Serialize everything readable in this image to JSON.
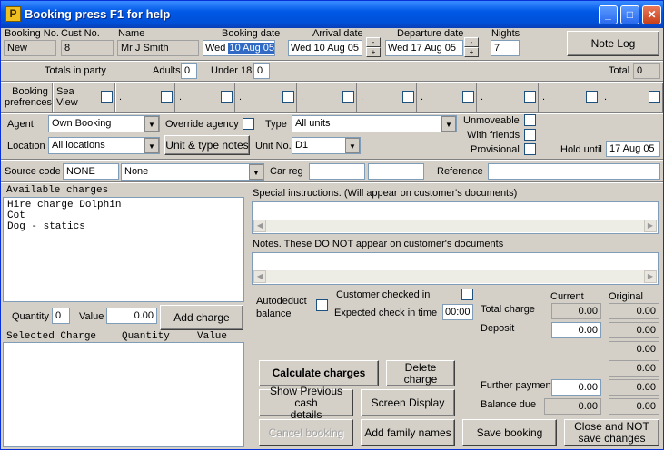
{
  "window": {
    "title": "Booking press F1 for help",
    "app_icon_letter": "P"
  },
  "header": {
    "booking_no_label": "Booking No.",
    "booking_no": "New",
    "cust_no_label": "Cust No.",
    "cust_no": "8",
    "name_label": "Name",
    "name": "Mr J Smith",
    "booking_date_label": "Booking date",
    "booking_day": "Wed",
    "booking_date": "10 Aug 05",
    "arrival_date_label": "Arrival date",
    "arrival_day": "Wed",
    "arrival_date": "10 Aug 05",
    "departure_date_label": "Departure date",
    "departure_day": "Wed",
    "departure_date": "17 Aug 05",
    "nights_label": "Nights",
    "nights": "7",
    "note_log_label": "Note Log"
  },
  "party": {
    "totals_label": "Totals in party",
    "adults_label": "Adults",
    "adults": "0",
    "under18_label": "Under 18",
    "under18": "0",
    "total_label": "Total",
    "total": "0"
  },
  "preferences": {
    "label_line1": "Booking",
    "label_line2": "prefrences",
    "sea_view_line1": "Sea",
    "sea_view_line2": "View",
    "dots": [
      ".",
      ".",
      ".",
      ".",
      ".",
      ".",
      ".",
      ".",
      "."
    ]
  },
  "agent": {
    "agent_label": "Agent",
    "agent_value": "Own Booking",
    "override_label": "Override agency",
    "type_label": "Type",
    "type_value": "All units",
    "unmoveable_label": "Unmoveable",
    "with_friends_label": "With friends",
    "provisional_label": "Provisional",
    "location_label": "Location",
    "location_value": "All locations",
    "unit_type_notes_label": "Unit & type notes",
    "unit_no_label": "Unit No.",
    "unit_no_value": "D1",
    "hold_until_label": "Hold until",
    "hold_until": "17 Aug 05"
  },
  "source": {
    "source_code_label": "Source code",
    "source_code": "NONE",
    "source_value": "None",
    "car_reg_label": "Car reg",
    "car_reg_1": "",
    "car_reg_2": "",
    "reference_label": "Reference",
    "reference": ""
  },
  "charges": {
    "available_label": "Available charges",
    "available_items": [
      "Hire charge Dolphin",
      "Cot",
      "Dog - statics"
    ],
    "quantity_label": "Quantity",
    "quantity": "0",
    "value_label": "Value",
    "value": "0.00",
    "add_charge_label": "Add charge",
    "selected_headers": [
      "Selected Charge",
      "Quantity",
      "Value"
    ]
  },
  "notes": {
    "special_label": "Special instructions. (Will appear on customer's documents)",
    "notes_label": "Notes. These DO NOT appear on customer's documents"
  },
  "checkin": {
    "autodeduct_line1": "Autodeduct",
    "autodeduct_line2": "balance",
    "customer_checked_in_label": "Customer checked in",
    "expected_checkin_label": "Expected check in time",
    "expected_checkin": "00:00"
  },
  "totals": {
    "current_label": "Current",
    "original_label": "Original",
    "total_charge_label": "Total charge",
    "total_charge_current": "0.00",
    "total_charge_original": "0.00",
    "deposit_label": "Deposit",
    "deposit_current": "0.00",
    "original_rows": [
      "0.00",
      "0.00",
      "0.00",
      "0.00",
      "0.00",
      "0.00"
    ],
    "further_payment_label": "Further payment",
    "further_payment": "0.00",
    "balance_due_label": "Balance due",
    "balance_due": "0.00"
  },
  "actions": {
    "calculate_label": "Calculate charges",
    "delete_charge_label": "Delete charge",
    "show_previous_line1": "Show Previous cash",
    "show_previous_line2": "details",
    "screen_display_label": "Screen Display",
    "cancel_booking_label": "Cancel booking",
    "add_family_label": "Add family names",
    "save_booking_label": "Save booking",
    "close_line1": "Close and NOT",
    "close_line2": "save changes"
  }
}
